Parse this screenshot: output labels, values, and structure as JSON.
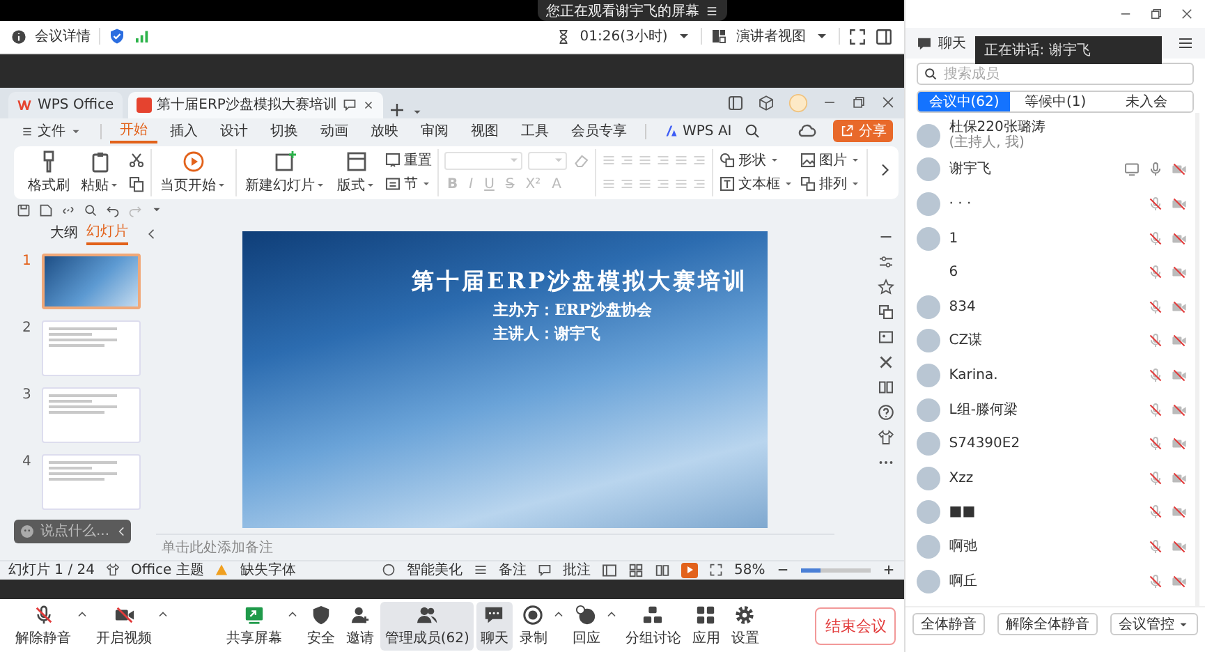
{
  "share_notice": "您正在观看谢宇飞的屏幕",
  "top_bar": {
    "meeting_info": "会议详情",
    "timer": "01:26(3小时)",
    "view_mode": "演讲者视图"
  },
  "wps": {
    "tabs": [
      {
        "label": "WPS Office",
        "selected": false
      },
      {
        "label": "第十届ERP沙盘模拟大赛培训",
        "selected": true
      }
    ],
    "menu": [
      {
        "label": "文件",
        "selected": false
      },
      {
        "label": "开始",
        "selected": true
      },
      {
        "label": "插入",
        "selected": false
      },
      {
        "label": "设计",
        "selected": false
      },
      {
        "label": "切换",
        "selected": false
      },
      {
        "label": "动画",
        "selected": false
      },
      {
        "label": "放映",
        "selected": false
      },
      {
        "label": "审阅",
        "selected": false
      },
      {
        "label": "视图",
        "selected": false
      },
      {
        "label": "工具",
        "selected": false
      },
      {
        "label": "会员专享",
        "selected": false
      },
      {
        "label": "WPS AI",
        "selected": false
      }
    ],
    "share_button": "分享",
    "ribbon": [
      {
        "kind": "items",
        "items": [
          {
            "kind": "large",
            "label": "格式刷",
            "dropdown": false
          },
          {
            "kind": "large",
            "label": "粘贴",
            "dropdown": true
          },
          {
            "kind": "icon"
          },
          {
            "kind": "icon"
          }
        ]
      },
      {
        "kind": "items",
        "items": [
          {
            "kind": "large",
            "label": "当页开始",
            "dropdown": true
          }
        ]
      },
      {
        "kind": "items",
        "items": [
          {
            "kind": "large",
            "label": "新建幻灯片",
            "dropdown": true
          },
          {
            "kind": "large",
            "label": "版式",
            "dropdown": true
          },
          {
            "kind": "small",
            "label": "重置",
            "dropdown": false
          },
          {
            "kind": "small",
            "label": "节",
            "dropdown": true
          }
        ]
      },
      {
        "kind": "font",
        "disabled": true,
        "buttons": [
          "B",
          "I",
          "U",
          "S",
          "X²",
          "A"
        ]
      },
      {
        "kind": "paragraph",
        "disabled": true
      },
      {
        "kind": "items",
        "items": [
          {
            "kind": "small",
            "label": "形状",
            "dropdown": true
          },
          {
            "kind": "small",
            "label": "文本框",
            "dropdown": true
          },
          {
            "kind": "small",
            "label": "图片",
            "dropdown": true
          },
          {
            "kind": "small",
            "label": "排列",
            "dropdown": true
          }
        ]
      }
    ],
    "slide_panel": {
      "tabs": [
        {
          "label": "大纲",
          "selected": false
        },
        {
          "label": "幻灯片",
          "selected": true
        }
      ],
      "thumbnails": [
        {
          "number": "1",
          "selected": true
        },
        {
          "number": "2",
          "selected": false
        },
        {
          "number": "3",
          "selected": false
        },
        {
          "number": "4",
          "selected": false
        }
      ],
      "comment_placeholder": "说点什么..."
    },
    "slide": {
      "title": "第十届ERP沙盘模拟大赛培训",
      "lines": [
        "主办方：ERP沙盘协会",
        "主讲人：谢宇飞"
      ]
    },
    "notes_placeholder": "单击此处添加备注",
    "status_bar": {
      "slide_counter": "幻灯片 1 / 24",
      "theme": "Office 主题",
      "missing_fonts": "缺失字体",
      "beautify": "智能美化",
      "notes": "备注",
      "comments": "批注",
      "zoom": "58%",
      "zoom_slider": {
        "level": 0.27
      }
    }
  },
  "toolbar": {
    "items": [
      {
        "label": "解除静音",
        "menu": true,
        "selected": false
      },
      {
        "label": "开启视频",
        "menu": true,
        "selected": false
      },
      {
        "label": "共享屏幕",
        "menu": true,
        "selected": false
      },
      {
        "label": "安全",
        "menu": false,
        "selected": false
      },
      {
        "label": "邀请",
        "menu": false,
        "selected": false
      },
      {
        "label": "管理成员(62)",
        "menu": false,
        "selected": true
      },
      {
        "label": "聊天",
        "menu": false,
        "selected": true
      },
      {
        "label": "录制",
        "menu": true,
        "selected": false
      },
      {
        "label": "回应",
        "menu": true,
        "selected": false
      },
      {
        "label": "分组讨论",
        "menu": false,
        "selected": false
      },
      {
        "label": "应用",
        "menu": false,
        "selected": false
      },
      {
        "label": "设置",
        "menu": false,
        "selected": false
      }
    ],
    "end_button": "结束会议"
  },
  "panel": {
    "chat_tab": "聊天",
    "speaking_notice": "正在讲话:  谢宇飞",
    "search_placeholder": "搜索成员",
    "tabs": [
      {
        "label": "会议中(62)",
        "selected": true
      },
      {
        "label": "等候中(1)",
        "selected": false
      },
      {
        "label": "未入会",
        "selected": false
      }
    ],
    "members": [
      {
        "kind": "host",
        "name": "杜保220张璐涛",
        "role": "(主持人, 我)",
        "avatar": true
      },
      {
        "kind": "member",
        "name": "谢宇飞",
        "avatar": true,
        "sharing": true,
        "muted": false,
        "video": false
      },
      {
        "kind": "member",
        "name": "· · ·",
        "avatar": true,
        "sharing": false,
        "muted": true,
        "video": false
      },
      {
        "kind": "member",
        "name": "1",
        "avatar": true,
        "sharing": false,
        "muted": true,
        "video": false
      },
      {
        "kind": "member",
        "name": "6",
        "avatar": false,
        "sharing": false,
        "muted": true,
        "video": false
      },
      {
        "kind": "member",
        "name": "834",
        "avatar": true,
        "sharing": false,
        "muted": true,
        "video": false
      },
      {
        "kind": "member",
        "name": "CZ谋",
        "avatar": true,
        "sharing": false,
        "muted": true,
        "video": false
      },
      {
        "kind": "member",
        "name": "Karina.",
        "avatar": true,
        "sharing": false,
        "muted": true,
        "video": false
      },
      {
        "kind": "member",
        "name": "L组-滕何梁",
        "avatar": true,
        "sharing": false,
        "muted": true,
        "video": false
      },
      {
        "kind": "member",
        "name": "S74390E2",
        "avatar": true,
        "sharing": false,
        "muted": true,
        "video": false
      },
      {
        "kind": "member",
        "name": "Xzz",
        "avatar": true,
        "sharing": false,
        "muted": true,
        "video": false
      },
      {
        "kind": "member",
        "name": "■■",
        "avatar": true,
        "sharing": false,
        "muted": true,
        "video": false
      },
      {
        "kind": "member",
        "name": "啊弛",
        "avatar": true,
        "sharing": false,
        "muted": true,
        "video": false
      },
      {
        "kind": "member",
        "name": "啊丘",
        "avatar": true,
        "sharing": false,
        "muted": true,
        "video": false
      }
    ],
    "footer_buttons": [
      {
        "label": "全体静音",
        "dropdown": false
      },
      {
        "label": "解除全体静音",
        "dropdown": false
      },
      {
        "label": "会议管控",
        "dropdown": true
      }
    ]
  }
}
